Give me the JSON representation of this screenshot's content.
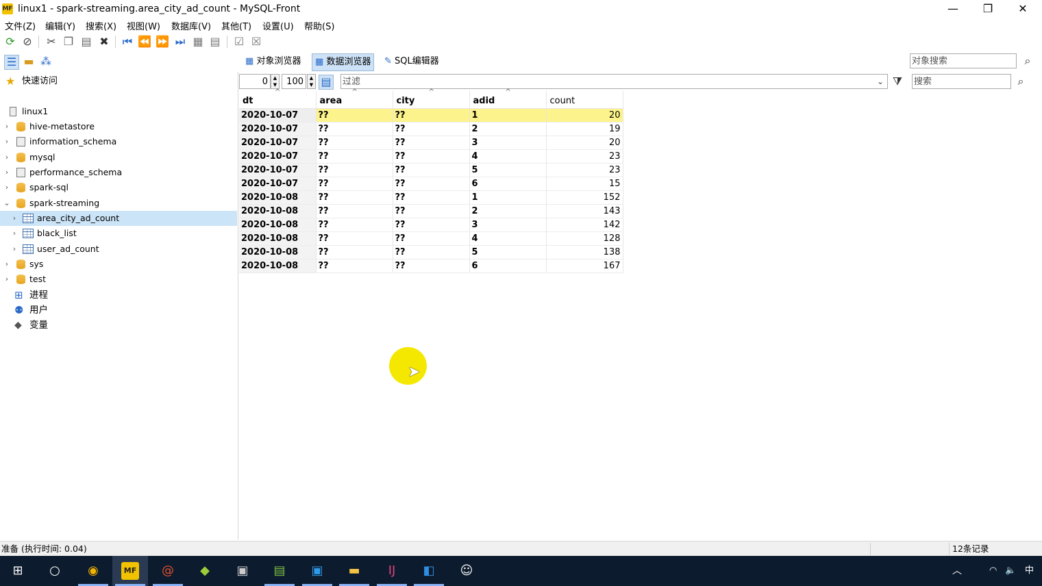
{
  "window": {
    "logo": "MF",
    "title": "linux1 - spark-streaming.area_city_ad_count - MySQL-Front",
    "controls": {
      "minimize": "—",
      "restore": "❐",
      "close": "✕"
    }
  },
  "menu": [
    "文件(Z)",
    "编辑(Y)",
    "搜索(X)",
    "视图(W)",
    "数据库(V)",
    "其他(T)",
    "设置(U)",
    "帮助(S)"
  ],
  "toolbar": {
    "icons": [
      "refresh-icon",
      "stop-icon",
      "cut-icon",
      "copy-icon",
      "paste-icon",
      "delete-icon",
      "first-icon",
      "prev-icon",
      "next-icon",
      "last-icon",
      "insert-record-icon",
      "delete-record-icon",
      "post-icon",
      "cancel-icon"
    ]
  },
  "views": {
    "object_browser": "对象浏览器",
    "data_browser": "数据浏览器",
    "sql_editor": "SQL编辑器",
    "object_search_placeholder": "对象搜索"
  },
  "quick_access": "快速访问",
  "tree": {
    "host": "linux1",
    "databases": [
      "hive-metastore",
      "information_schema",
      "mysql",
      "performance_schema",
      "spark-sql",
      "spark-streaming"
    ],
    "tables": [
      "area_city_ad_count",
      "black_list",
      "user_ad_count"
    ],
    "databases_after": [
      "sys",
      "test"
    ],
    "system": [
      "进程",
      "用户",
      "变量"
    ]
  },
  "filterbar": {
    "offset": "0",
    "limit": "100",
    "filter_placeholder": "过滤",
    "search_placeholder": "搜索"
  },
  "grid": {
    "columns": [
      "dt",
      "area",
      "city",
      "adid",
      "count"
    ],
    "rows": [
      [
        "2020-10-07",
        "??",
        "??",
        "1",
        "20"
      ],
      [
        "2020-10-07",
        "??",
        "??",
        "2",
        "19"
      ],
      [
        "2020-10-07",
        "??",
        "??",
        "3",
        "20"
      ],
      [
        "2020-10-07",
        "??",
        "??",
        "4",
        "23"
      ],
      [
        "2020-10-07",
        "??",
        "??",
        "5",
        "23"
      ],
      [
        "2020-10-07",
        "??",
        "??",
        "6",
        "15"
      ],
      [
        "2020-10-08",
        "??",
        "??",
        "1",
        "152"
      ],
      [
        "2020-10-08",
        "??",
        "??",
        "2",
        "143"
      ],
      [
        "2020-10-08",
        "??",
        "??",
        "3",
        "142"
      ],
      [
        "2020-10-08",
        "??",
        "??",
        "4",
        "128"
      ],
      [
        "2020-10-08",
        "??",
        "??",
        "5",
        "138"
      ],
      [
        "2020-10-08",
        "??",
        "??",
        "6",
        "167"
      ]
    ]
  },
  "status": {
    "left": "准备 (执行时间: 0.04)",
    "right": "12条记录"
  },
  "taskbar": {
    "apps": [
      "windows-start-icon",
      "cortana-icon",
      "chrome-icon",
      "mysql-front-icon",
      "snail-app-icon",
      "mind-map-icon",
      "terminal-icon",
      "notepad-icon",
      "remote-desktop-icon",
      "file-explorer-icon",
      "intellij-icon",
      "vscode-icon",
      "smiley-app-icon"
    ],
    "tray_time": "中"
  },
  "colors": {
    "highlight_row": "#fdf38c",
    "selected_tree": "#cce4f7",
    "taskbar": "#0d1b2e"
  }
}
